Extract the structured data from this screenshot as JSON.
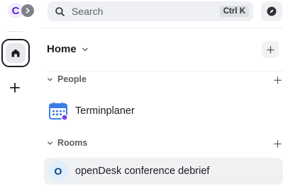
{
  "rail": {
    "account_initial": "C",
    "home_icon": "home-icon",
    "add_icon": "plus-icon"
  },
  "search": {
    "placeholder": "Search",
    "shortcut": "Ctrl K"
  },
  "home": {
    "title": "Home"
  },
  "sections": {
    "people": {
      "label": "People"
    },
    "rooms": {
      "label": "Rooms"
    }
  },
  "people": [
    {
      "name": "Terminplaner",
      "icon": "calendar-icon"
    }
  ],
  "rooms": [
    {
      "name": "openDesk conference debrief",
      "initial": "O"
    }
  ],
  "colors": {
    "accent": "#5a1fc9",
    "presence": "#7b3ff2",
    "calendar": "#3c7de6"
  }
}
